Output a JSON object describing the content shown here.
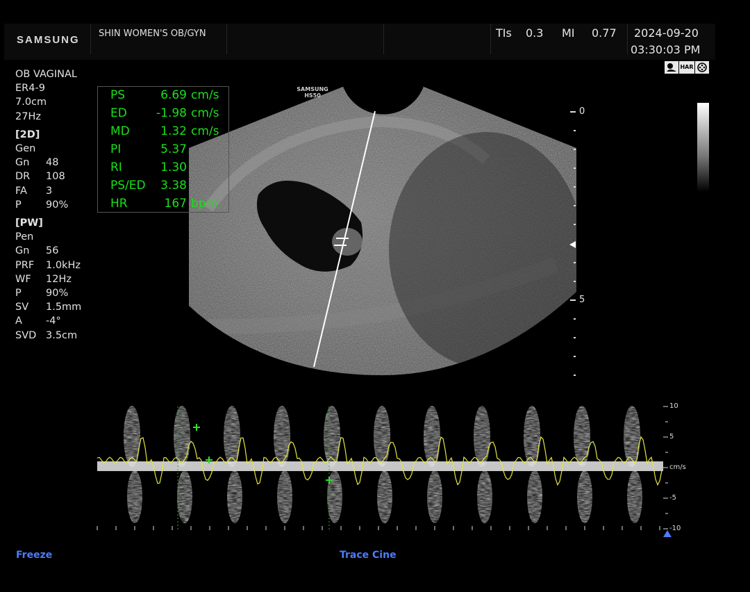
{
  "header": {
    "brand": "SAMSUNG",
    "hospital": "SHIN WOMEN'S OB/GYN",
    "tis_label": "TIs",
    "tis_value": "0.3",
    "mi_label": "MI",
    "mi_value": "0.77",
    "date": "2024-09-20",
    "time": "03:30:03 PM",
    "preset_icons": [
      "baby-icon",
      "HAR",
      "film-reel-icon"
    ]
  },
  "probe": {
    "exam": "OB VAGINAL",
    "transducer": "ER4-9",
    "depth": "7.0cm",
    "frame_rate": "27Hz"
  },
  "mode_2d": {
    "title": "[2D]",
    "preset": "Gen",
    "params": [
      {
        "k": "Gn",
        "v": "48"
      },
      {
        "k": "DR",
        "v": "108"
      },
      {
        "k": "FA",
        "v": "3"
      },
      {
        "k": "P",
        "v": "90%"
      }
    ]
  },
  "mode_pw": {
    "title": "[PW]",
    "preset": "Pen",
    "params": [
      {
        "k": "Gn",
        "v": "56"
      },
      {
        "k": "PRF",
        "v": "1.0kHz"
      },
      {
        "k": "WF",
        "v": "12Hz"
      },
      {
        "k": "P",
        "v": "90%"
      },
      {
        "k": "SV",
        "v": "1.5mm"
      },
      {
        "k": "A",
        "v": "-4°"
      },
      {
        "k": "SVD",
        "v": "3.5cm"
      }
    ]
  },
  "measurements": [
    {
      "label": "PS",
      "value": "6.69",
      "unit": "cm/s"
    },
    {
      "label": "ED",
      "value": "-1.98",
      "unit": "cm/s"
    },
    {
      "label": "MD",
      "value": "1.32",
      "unit": "cm/s"
    },
    {
      "label": "PI",
      "value": "5.37",
      "unit": ""
    },
    {
      "label": "RI",
      "value": "1.30",
      "unit": ""
    },
    {
      "label": "PS/ED",
      "value": "3.38",
      "unit": ""
    },
    {
      "label": "HR",
      "value": "167",
      "unit": "bpm"
    }
  ],
  "image": {
    "probe_label_1": "SAMSUNG",
    "probe_label_2": "HS50",
    "depth_marks": [
      "0",
      "5"
    ]
  },
  "doppler": {
    "velocity_scale": [
      "10",
      "5",
      "cm/s",
      "-5",
      "-10"
    ]
  },
  "softkeys": {
    "left": "Freeze",
    "middle": "Trace Cine"
  },
  "colors": {
    "measurement_text": "#19e019",
    "softkey_text": "#4d7bff",
    "trace": "#e6e640"
  }
}
